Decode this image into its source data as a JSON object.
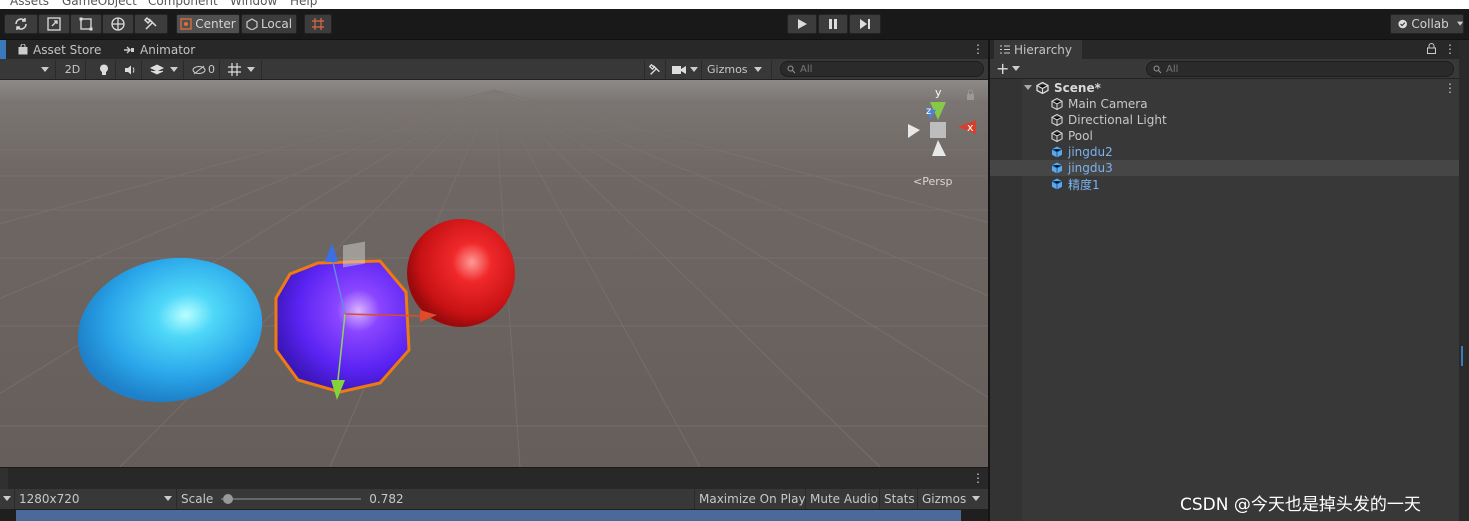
{
  "menu": [
    "Assets",
    "GameObject",
    "Component",
    "Window",
    "Help"
  ],
  "toolbar": {
    "pivot_label": "Center",
    "space_label": "Local",
    "collab_label": "Collab"
  },
  "scene_tabs": [
    {
      "label": "Asset Store",
      "icon": "bag-icon"
    },
    {
      "label": "Animator",
      "icon": "animator-icon"
    }
  ],
  "scene_toolbar": {
    "mode_2d": "2D",
    "hidden_count": "0",
    "gizmos_label": "Gizmos",
    "search_placeholder": "All"
  },
  "scene_view": {
    "projection_label": "Persp",
    "axis_labels": {
      "x": "x",
      "y": "y",
      "z": "z"
    },
    "colors": {
      "sphere_blue": "#2fb0ee",
      "sphere_purple": "#6a2cff",
      "sphere_red": "#e0181c",
      "selection": "#f07a12"
    }
  },
  "game_toolbar": {
    "resolution": "1280x720",
    "scale_label": "Scale",
    "scale_value": "0.782",
    "maximize_on_play": "Maximize On Play",
    "mute_audio": "Mute Audio",
    "stats": "Stats",
    "gizmos": "Gizmos"
  },
  "hierarchy": {
    "tab_label": "Hierarchy",
    "search_placeholder": "All",
    "scene_name": "Scene*",
    "items": [
      {
        "label": "Main Camera",
        "type": "gameobject",
        "selected": false
      },
      {
        "label": "Directional Light",
        "type": "gameobject",
        "selected": false
      },
      {
        "label": "Pool",
        "type": "gameobject",
        "selected": false
      },
      {
        "label": "jingdu2",
        "type": "prefab",
        "selected": false
      },
      {
        "label": "jingdu3",
        "type": "prefab",
        "selected": true
      },
      {
        "label": "精度1",
        "type": "prefab",
        "selected": false
      }
    ]
  },
  "watermark": "CSDN @今天也是掉头发的一天"
}
